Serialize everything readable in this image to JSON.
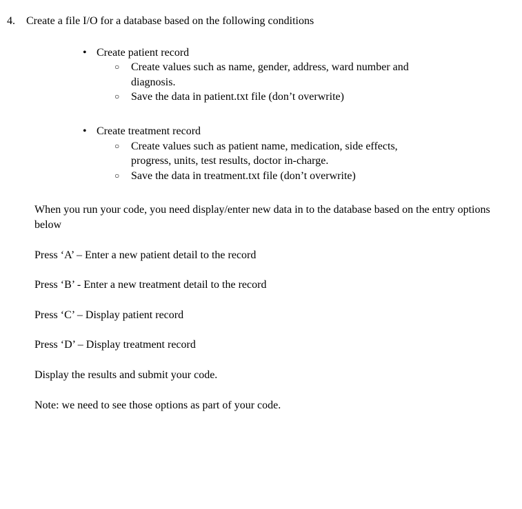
{
  "question": {
    "number": "4.",
    "title": "Create a file I/O for a database based on the following conditions"
  },
  "bullets": [
    {
      "label": "Create patient record",
      "subs": [
        "Create values such as name, gender, address, ward number and diagnosis.",
        "Save the data in patient.txt file (don’t overwrite)"
      ]
    },
    {
      "label": "Create treatment record",
      "subs": [
        "Create values such as patient name, medication, side effects, progress, units, test results, doctor in-charge.",
        "Save the data in treatment.txt file (don’t overwrite)"
      ]
    }
  ],
  "paras": {
    "intro": "When you run your code, you need display/enter new data in to the database based on the entry options below",
    "optA": "Press ‘A’ – Enter a new patient detail to the record",
    "optB": "Press ‘B’ - Enter a new treatment detail to the record",
    "optC": "Press ‘C’ – Display patient record",
    "optD": "Press ‘D’ – Display treatment record",
    "submit": "Display the results and submit your code.",
    "note": "Note: we need to see those options as part of your code."
  }
}
